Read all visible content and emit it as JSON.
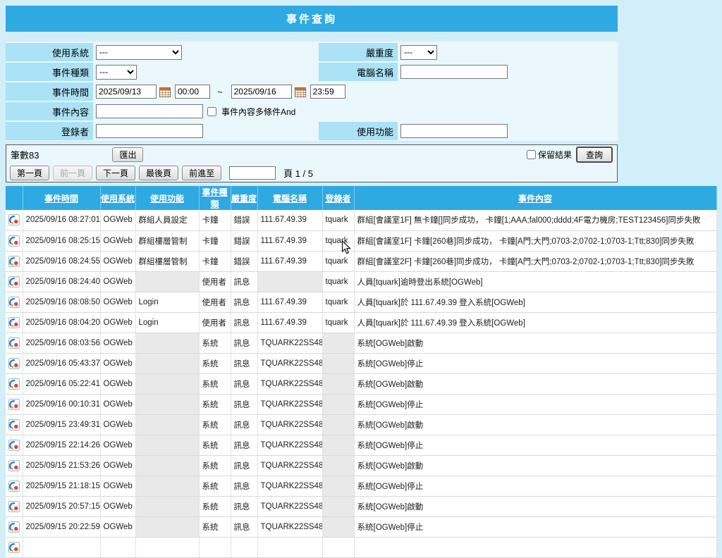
{
  "colors": {
    "accent": "#2fa9e1",
    "panel": "#eaf7fd",
    "label_chip": "#abe2f5",
    "page_bg": "#d2eef9"
  },
  "header": {
    "title": "事件查詢"
  },
  "filters": {
    "system": {
      "label": "使用系統",
      "value": "---"
    },
    "severity": {
      "label": "嚴重度",
      "value": "---"
    },
    "event_kind": {
      "label": "事件種類",
      "value": "---"
    },
    "computer_name": {
      "label": "電腦名稱",
      "value": ""
    },
    "event_time": {
      "label": "事件時間",
      "start_date": "2025/09/13",
      "start_time": "00:00",
      "separator": "~",
      "end_date": "2025/09/16",
      "end_time": "23:59"
    },
    "event_content": {
      "label": "事件內容",
      "value": "",
      "and_label": "事件內容多條件And"
    },
    "logger": {
      "label": "登錄者",
      "value": ""
    },
    "function": {
      "label": "使用功能",
      "value": ""
    }
  },
  "results_bar": {
    "count": "筆數83",
    "export": "匯出",
    "keep_results": "保留結果",
    "query": "查詢"
  },
  "pagination": {
    "first": "第一頁",
    "prev": "前一頁",
    "next": "下一頁",
    "last": "最後頁",
    "goto": "前進至",
    "goto_value": "",
    "page_info": "頁 1 / 5"
  },
  "icons": {
    "row_icon": "event-detail-icon",
    "calendar_icon": "calendar-icon",
    "cursor": "mouse-cursor"
  },
  "table": {
    "columns": [
      "事件時間",
      "使用系統",
      "使用功能",
      "事件種類",
      "嚴重度",
      "電腦名稱",
      "登錄者",
      "事件內容"
    ],
    "rows": [
      {
        "time": "2025/09/16 08:27:01",
        "system": "OGWeb",
        "func": "群組人員設定",
        "kind": "卡鐘",
        "severity": "錯誤",
        "computer": "111.67.49.39",
        "logger": "tquark",
        "content": "群組[會議室1F] 無卡鐘[]同步成功， 卡鐘[1;AAA;fal000;dddd;4F電力機房;TEST123456]同步失敗"
      },
      {
        "time": "2025/09/16 08:25:15",
        "system": "OGWeb",
        "func": "群組樓層管制",
        "kind": "卡鐘",
        "severity": "錯誤",
        "computer": "111.67.49.39",
        "logger": "tquark",
        "content": "群組[會議室1F] 卡鐘[260巷]同步成功， 卡鐘[A門;大門;0703-2;0702-1;0703-1;Ttt;830]同步失敗"
      },
      {
        "time": "2025/09/16 08:24:55",
        "system": "OGWeb",
        "func": "群組樓層管制",
        "kind": "卡鐘",
        "severity": "錯誤",
        "computer": "111.67.49.39",
        "logger": "tquark",
        "content": "群組[會議室2F] 卡鐘[260巷]同步成功， 卡鐘[A門;大門;0703-2;0702-1;0703-1;Ttt;830]同步失敗"
      },
      {
        "time": "2025/09/16 08:24:40",
        "system": "OGWeb",
        "func": "",
        "kind": "使用者",
        "severity": "訊息",
        "computer": "",
        "logger": "tquark",
        "content": "人員[tquark]逾時登出系統[OGWeb]"
      },
      {
        "time": "2025/09/16 08:08:50",
        "system": "OGWeb",
        "func": "Login",
        "kind": "使用者",
        "severity": "訊息",
        "computer": "111.67.49.39",
        "logger": "tquark",
        "content": "人員[tquark]於 111.67.49.39 登入系統[OGWeb]"
      },
      {
        "time": "2025/09/16 08:04:20",
        "system": "OGWeb",
        "func": "Login",
        "kind": "使用者",
        "severity": "訊息",
        "computer": "111.67.49.39",
        "logger": "tquark",
        "content": "人員[tquark]於 111.67.49.39 登入系統[OGWeb]"
      },
      {
        "time": "2025/09/16 08:03:56",
        "system": "OGWeb",
        "func": "",
        "kind": "系統",
        "severity": "訊息",
        "computer": "TQUARK22SS48",
        "logger": "",
        "content": "系統[OGWeb]啟動"
      },
      {
        "time": "2025/09/16 05:43:37",
        "system": "OGWeb",
        "func": "",
        "kind": "系統",
        "severity": "訊息",
        "computer": "TQUARK22SS48",
        "logger": "",
        "content": "系統[OGWeb]停止"
      },
      {
        "time": "2025/09/16 05:22:41",
        "system": "OGWeb",
        "func": "",
        "kind": "系統",
        "severity": "訊息",
        "computer": "TQUARK22SS48",
        "logger": "",
        "content": "系統[OGWeb]啟動"
      },
      {
        "time": "2025/09/16 00:10:31",
        "system": "OGWeb",
        "func": "",
        "kind": "系統",
        "severity": "訊息",
        "computer": "TQUARK22SS48",
        "logger": "",
        "content": "系統[OGWeb]停止"
      },
      {
        "time": "2025/09/15 23:49:31",
        "system": "OGWeb",
        "func": "",
        "kind": "系統",
        "severity": "訊息",
        "computer": "TQUARK22SS48",
        "logger": "",
        "content": "系統[OGWeb]啟動"
      },
      {
        "time": "2025/09/15 22:14:26",
        "system": "OGWeb",
        "func": "",
        "kind": "系統",
        "severity": "訊息",
        "computer": "TQUARK22SS48",
        "logger": "",
        "content": "系統[OGWeb]停止"
      },
      {
        "time": "2025/09/15 21:53:26",
        "system": "OGWeb",
        "func": "",
        "kind": "系統",
        "severity": "訊息",
        "computer": "TQUARK22SS48",
        "logger": "",
        "content": "系統[OGWeb]啟動"
      },
      {
        "time": "2025/09/15 21:18:15",
        "system": "OGWeb",
        "func": "",
        "kind": "系統",
        "severity": "訊息",
        "computer": "TQUARK22SS48",
        "logger": "",
        "content": "系統[OGWeb]停止"
      },
      {
        "time": "2025/09/15 20:57:15",
        "system": "OGWeb",
        "func": "",
        "kind": "系統",
        "severity": "訊息",
        "computer": "TQUARK22SS48",
        "logger": "",
        "content": "系統[OGWeb]啟動"
      },
      {
        "time": "2025/09/15 20:22:59",
        "system": "OGWeb",
        "func": "",
        "kind": "系統",
        "severity": "訊息",
        "computer": "TQUARK22SS48",
        "logger": "",
        "content": "系統[OGWeb]停止"
      },
      {
        "partial": true,
        "time": "",
        "system": "",
        "func": "",
        "kind": "",
        "severity": "",
        "computer": "",
        "logger": "",
        "content": ""
      }
    ]
  }
}
